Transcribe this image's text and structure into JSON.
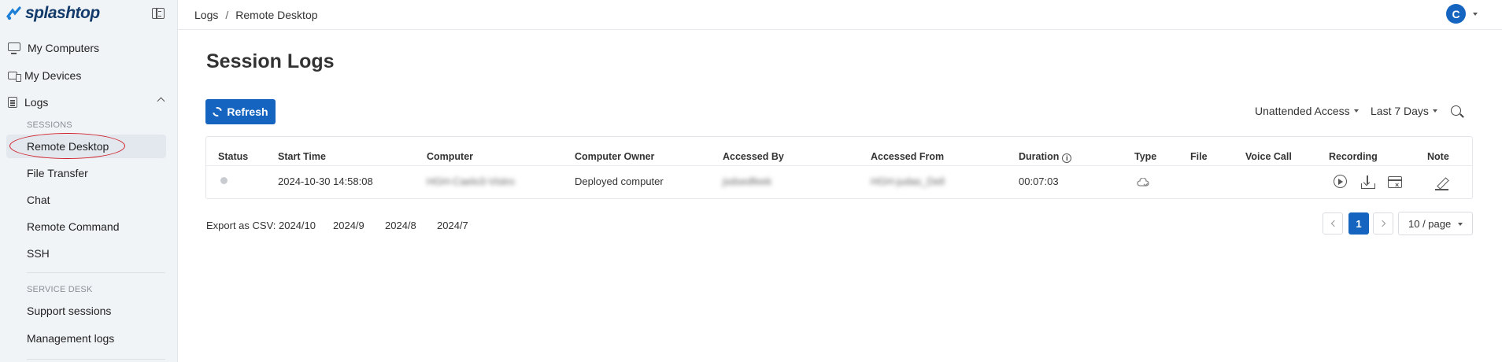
{
  "brand": {
    "name": "splashtop"
  },
  "sidebar": {
    "items": [
      {
        "label": "My Computers",
        "icon": "monitor-icon"
      },
      {
        "label": "My Devices",
        "icon": "devices-icon"
      },
      {
        "label": "Logs",
        "icon": "logs-icon"
      }
    ],
    "sessions_label": "SESSIONS",
    "sessions": [
      "Remote Desktop",
      "File Transfer",
      "Chat",
      "Remote Command",
      "SSH"
    ],
    "service_desk_label": "SERVICE DESK",
    "service_desk": [
      "Support sessions",
      "Management logs"
    ],
    "active": "Remote Desktop"
  },
  "breadcrumb": {
    "parent": "Logs",
    "separator": "/",
    "current": "Remote Desktop"
  },
  "user": {
    "initial": "C"
  },
  "page": {
    "title": "Session Logs"
  },
  "toolbar": {
    "refresh_label": "Refresh",
    "access_filter": "Unattended Access",
    "date_filter": "Last 7 Days"
  },
  "table": {
    "columns": [
      "Status",
      "Start Time",
      "Computer",
      "Computer Owner",
      "Accessed By",
      "Accessed From",
      "Duration",
      "Type",
      "File",
      "Voice Call",
      "Recording",
      "Note"
    ],
    "rows": [
      {
        "start_time": "2024-10-30 14:58:08",
        "computer": "HGH-Caelo3-Vistro",
        "computer_owner": "Deployed computer",
        "accessed_by": "jsdsedfeek",
        "accessed_from": "HGH-judas_Dell",
        "duration": "00:07:03"
      }
    ]
  },
  "export": {
    "label": "Export as CSV:",
    "months": [
      "2024/10",
      "2024/9",
      "2024/8",
      "2024/7"
    ]
  },
  "pagination": {
    "current": "1",
    "page_size": "10 / page"
  },
  "colors": {
    "accent": "#1565c0",
    "highlight_ring": "#d0202a"
  }
}
